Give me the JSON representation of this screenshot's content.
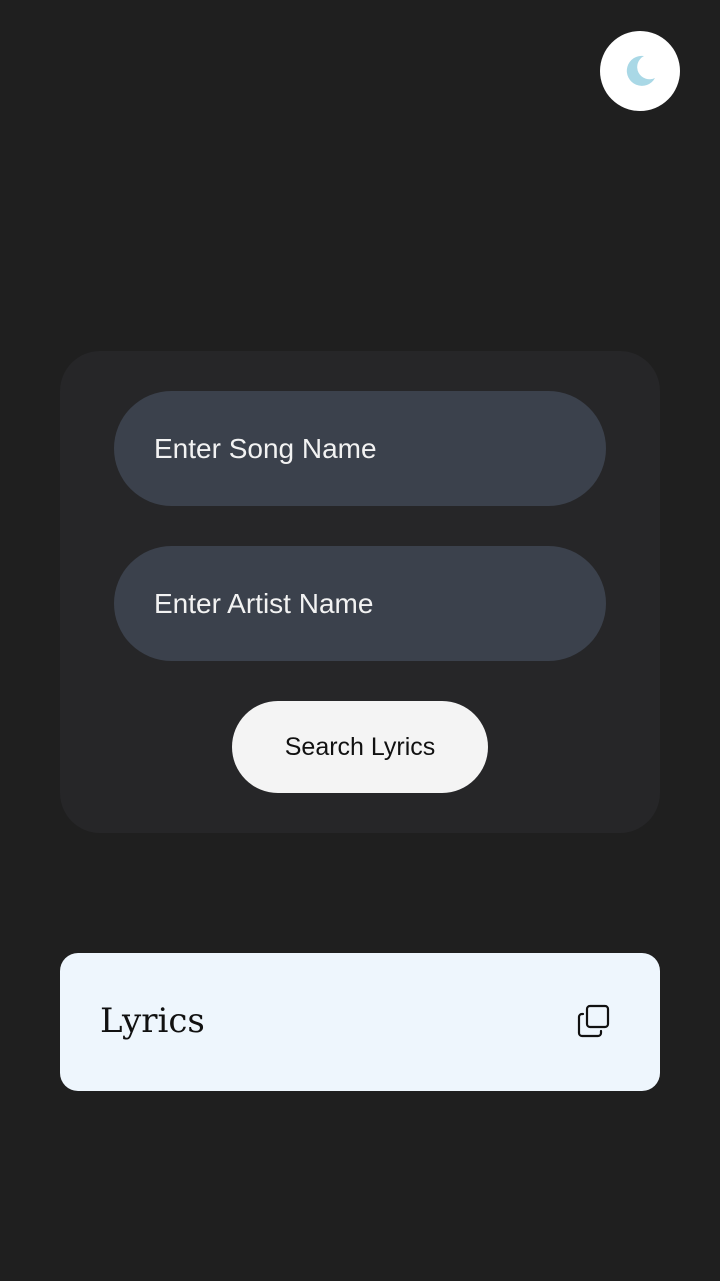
{
  "theme_toggle": {
    "icon": "moon-icon",
    "icon_color": "#a9d8e6"
  },
  "search_form": {
    "song_input": {
      "placeholder": "Enter Song Name",
      "value": ""
    },
    "artist_input": {
      "placeholder": "Enter Artist Name",
      "value": ""
    },
    "search_button_label": "Search Lyrics"
  },
  "lyrics_panel": {
    "title": "Lyrics",
    "copy_icon": "copy-icon"
  },
  "colors": {
    "background": "#1f1f1f",
    "card": "#262628",
    "input": "#3b414c",
    "button": "#f4f4f4",
    "lyrics_card": "#eef6fd"
  }
}
